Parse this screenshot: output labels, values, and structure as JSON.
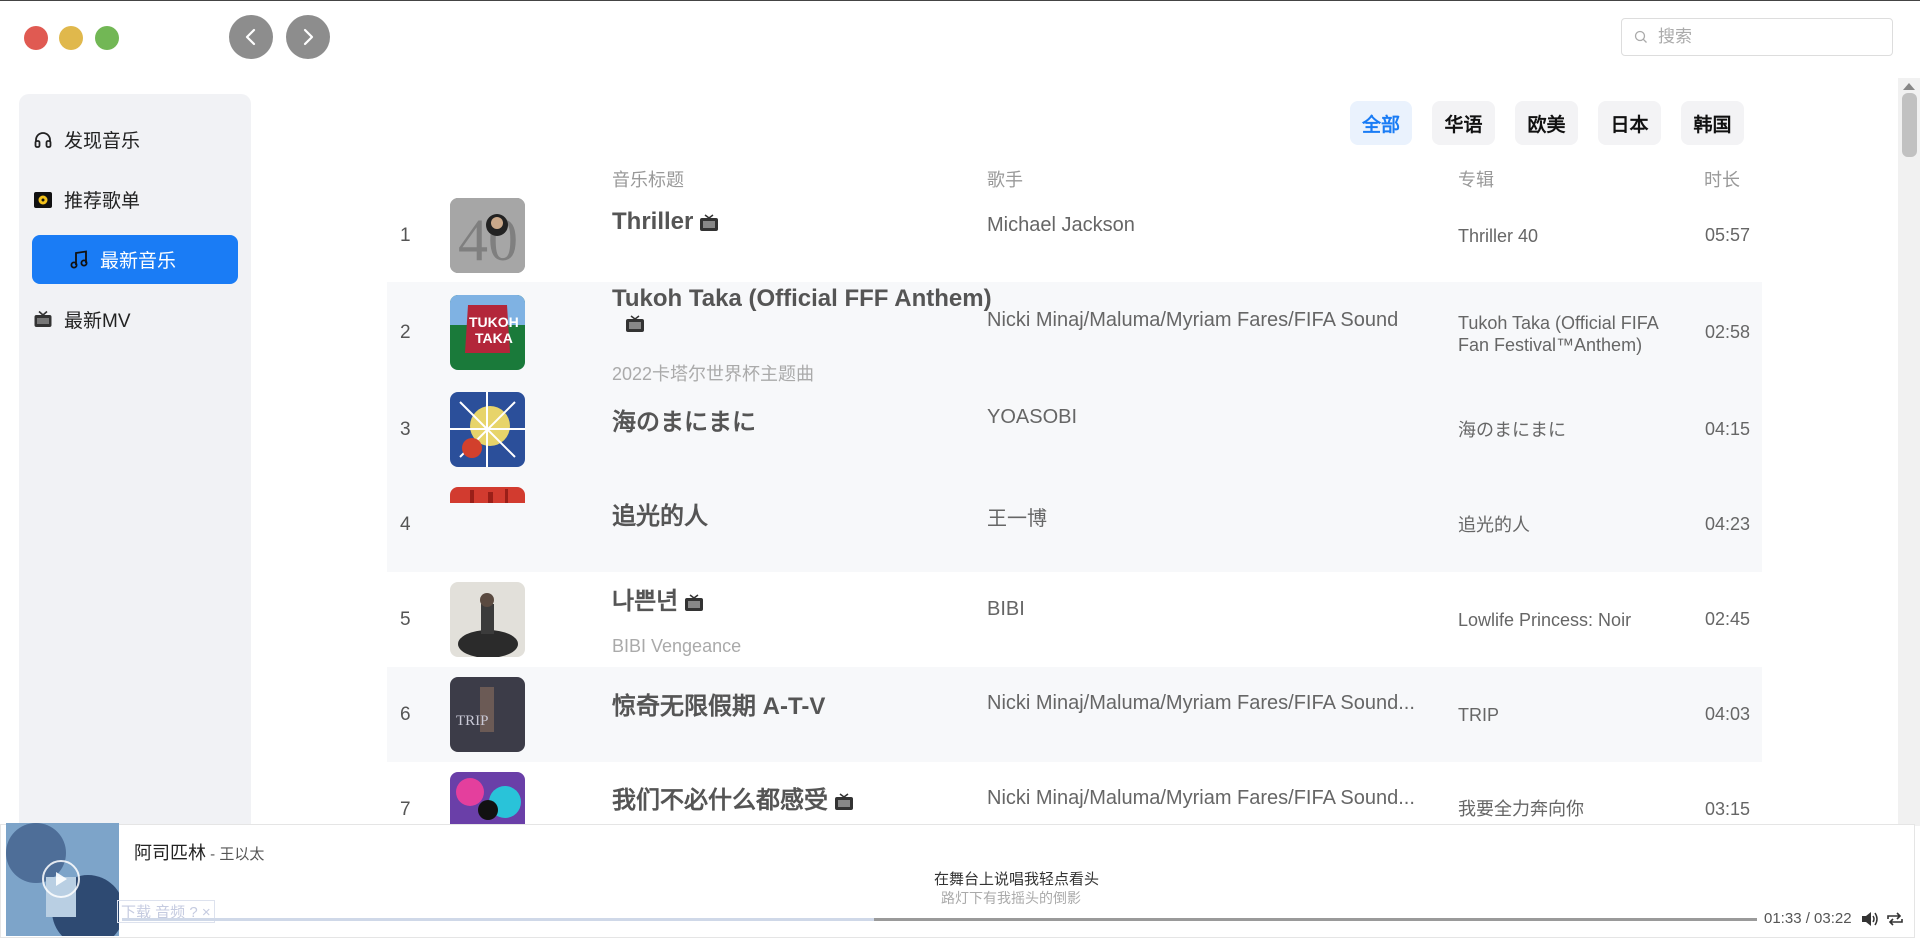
{
  "search": {
    "placeholder": "搜索"
  },
  "sidebar": {
    "items": [
      {
        "label": "发现音乐",
        "icon": "headphones-icon"
      },
      {
        "label": "推荐歌单",
        "icon": "playlist-icon"
      },
      {
        "label": "最新音乐",
        "icon": "music-note-icon",
        "active": true
      },
      {
        "label": "最新MV",
        "icon": "tv-icon"
      }
    ]
  },
  "filters": [
    {
      "label": "全部",
      "active": true
    },
    {
      "label": "华语"
    },
    {
      "label": "欧美"
    },
    {
      "label": "日本"
    },
    {
      "label": "韩国"
    }
  ],
  "table": {
    "headers": {
      "title": "音乐标题",
      "artist": "歌手",
      "album": "专辑",
      "duration": "时长"
    },
    "rows": [
      {
        "index": "1",
        "title": "Thriller",
        "mv": true,
        "subtitle": "",
        "artist": "Michael Jackson",
        "album": "Thriller 40",
        "duration": "05:57",
        "cover_color": "#9a9a9a"
      },
      {
        "index": "2",
        "title": "Tukoh Taka (Official FFF Anthem)",
        "mv": true,
        "subtitle": "2022卡塔尔世界杯主题曲",
        "artist": "Nicki Minaj/Maluma/Myriam Fares/FIFA Sound",
        "album": "Tukoh Taka (Official FIFA Fan Festival™Anthem)",
        "duration": "02:58",
        "cover_color": "#b3263a"
      },
      {
        "index": "3",
        "title": "海のまにまに",
        "mv": false,
        "subtitle": "",
        "artist": "YOASOBI",
        "album": "海のまにまに",
        "duration": "04:15",
        "cover_color": "#2b4f9a"
      },
      {
        "index": "4",
        "title": "追光的人",
        "mv": false,
        "subtitle": "",
        "artist": "王一博",
        "album": "追光的人",
        "duration": "04:23",
        "cover_color": "#d23b2f"
      },
      {
        "index": "5",
        "title": "나쁜년",
        "mv": true,
        "subtitle": "BIBI Vengeance",
        "artist": "BIBI",
        "album": "Lowlife Princess: Noir",
        "duration": "02:45",
        "cover_color": "#d8d6cf"
      },
      {
        "index": "6",
        "title": "惊奇无限假期 A-T-V",
        "mv": false,
        "subtitle": "",
        "artist": "Nicki Minaj/Maluma/Myriam Fares/FIFA Sound...",
        "album": "TRIP",
        "duration": "04:03",
        "cover_color": "#3c3c48"
      },
      {
        "index": "7",
        "title": "我们不必什么都感受",
        "mv": true,
        "subtitle": "",
        "artist": "Nicki Minaj/Maluma/Myriam Fares/FIFA Sound...",
        "album": "我要全力奔向你",
        "duration": "03:15",
        "cover_color": "#6a3fa8"
      }
    ]
  },
  "player": {
    "song": "阿司匹林",
    "artist_sep": " - ",
    "artist": "王以太",
    "lyric_current": "在舞台上说唱我轻点看头",
    "lyric_next": "路灯下有我摇头的倒影",
    "time": "01:33 / 03:22",
    "progress": 0.46,
    "watermark": "下载 音频",
    "watermark_extra": "? ×"
  },
  "colors": {
    "accent": "#1a7cf5"
  }
}
